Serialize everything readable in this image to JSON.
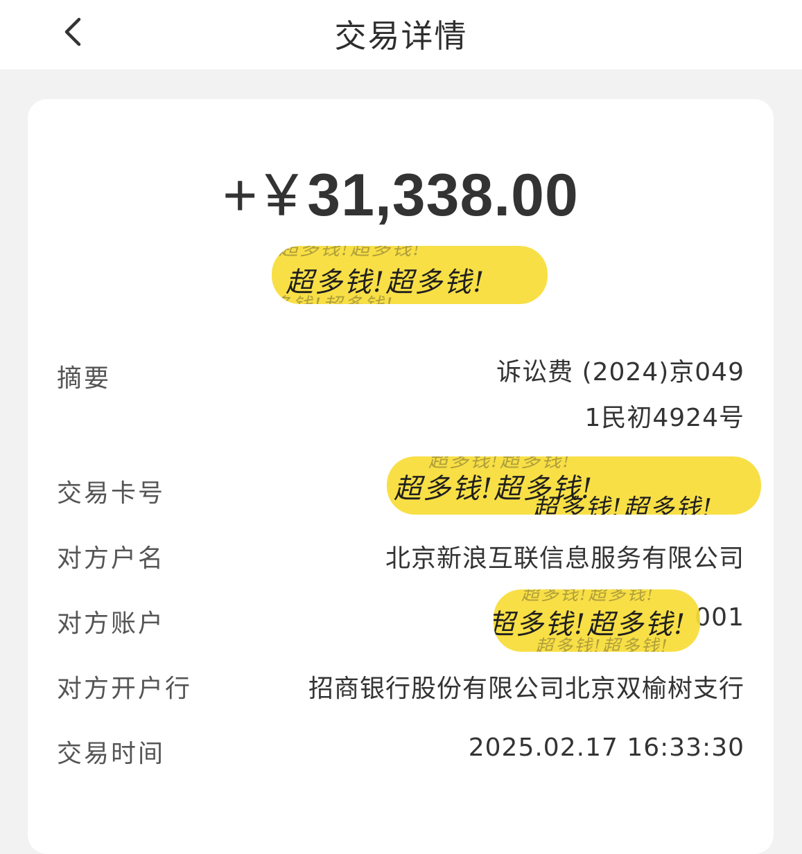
{
  "header": {
    "title": "交易详情",
    "back_icon": "chevron-left-icon"
  },
  "amount": {
    "sign": "+",
    "currency": "¥",
    "value": "31,338.00"
  },
  "redaction_text": "超多钱!超多钱!",
  "details": {
    "summary": {
      "label": "摘要",
      "value_line1": "诉讼费 (2024)京049",
      "value_line2": "1民初4924号"
    },
    "card_number": {
      "label": "交易卡号"
    },
    "counterparty_name": {
      "label": "对方户名",
      "value": "北京新浪互联信息服务有限公司"
    },
    "counterparty_account": {
      "label": "对方账户",
      "value_suffix": "001"
    },
    "counterparty_bank": {
      "label": "对方开户行",
      "value": "招商银行股份有限公司北京双榆树支行"
    },
    "trade_time": {
      "label": "交易时间",
      "value": "2025.02.17 16:33:30"
    }
  },
  "colors": {
    "background": "#f2f2f2",
    "card": "#ffffff",
    "text": "#333333",
    "label": "#555555",
    "highlight": "#f7dc36"
  }
}
